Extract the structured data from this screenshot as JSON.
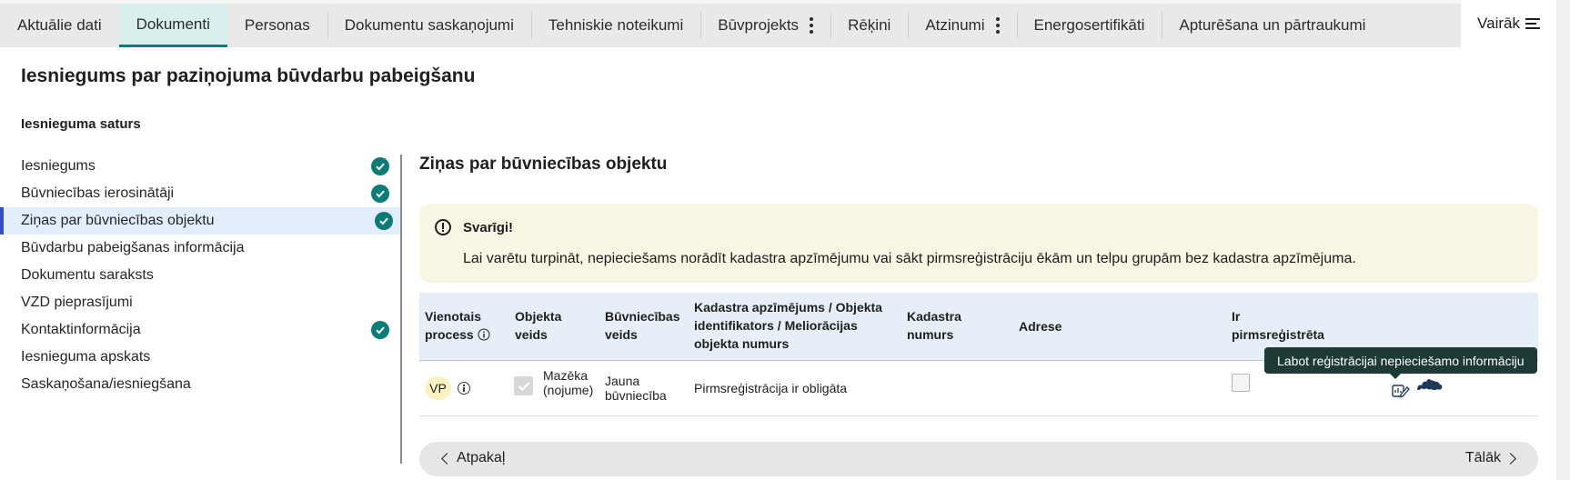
{
  "tabs": [
    {
      "label": "Aktuālie dati",
      "active": false,
      "has_menu": false
    },
    {
      "label": "Dokumenti",
      "active": true,
      "has_menu": false
    },
    {
      "label": "Personas",
      "active": false,
      "has_menu": false
    },
    {
      "label": "Dokumentu saskaņojumi",
      "active": false,
      "has_menu": false
    },
    {
      "label": "Tehniskie noteikumi",
      "active": false,
      "has_menu": false
    },
    {
      "label": "Būvprojekts",
      "active": false,
      "has_menu": true
    },
    {
      "label": "Rēķini",
      "active": false,
      "has_menu": false
    },
    {
      "label": "Atzinumi",
      "active": false,
      "has_menu": true
    },
    {
      "label": "Energosertifikāti",
      "active": false,
      "has_menu": false
    },
    {
      "label": "Apturēšana un pārtraukumi",
      "active": false,
      "has_menu": false
    }
  ],
  "more_tab": {
    "label": "Vairāk"
  },
  "page_title": "Iesniegums par paziņojuma būvdarbu pabeigšanu",
  "section_label": "Iesnieguma saturs",
  "steps": [
    {
      "label": "Iesniegums",
      "completed": true,
      "active": false
    },
    {
      "label": "Būvniecības ierosinātāji",
      "completed": true,
      "active": false
    },
    {
      "label": "Ziņas par būvniecības objektu",
      "completed": true,
      "active": true
    },
    {
      "label": "Būvdarbu pabeigšanas informācija",
      "completed": false,
      "active": false
    },
    {
      "label": "Dokumentu saraksts",
      "completed": false,
      "active": false
    },
    {
      "label": "VZD pieprasījumi",
      "completed": false,
      "active": false
    },
    {
      "label": "Kontaktinformācija",
      "completed": true,
      "active": false
    },
    {
      "label": "Iesnieguma apskats",
      "completed": false,
      "active": false
    },
    {
      "label": "Saskaņošana/iesniegšana",
      "completed": false,
      "active": false
    }
  ],
  "content": {
    "title": "Ziņas par būvniecības objektu",
    "alert": {
      "title": "Svarīgi!",
      "text": "Lai varētu turpināt, nepieciešams norādīt kadastra apzīmējumu vai sākt pirmsreģistrāciju ēkām un telpu grupām bez kadastra apzīmējuma."
    },
    "table": {
      "headers": {
        "unified_process": "Vienotais process",
        "object_type_1": "Objekta",
        "object_type_2": "veids",
        "construction_type_1": "Būvniecības",
        "construction_type_2": "veids",
        "cadastre_1": "Kadastra apzīmējums / Objekta",
        "cadastre_2": "identifikators / Meliorācijas",
        "cadastre_3": "objekta numurs",
        "cadastre_number_1": "Kadastra",
        "cadastre_number_2": "numurs",
        "address": "Adrese",
        "preregistered_1": "Ir",
        "preregistered_2": "pirmsreģistrēta"
      },
      "row": {
        "process_badge": "VP",
        "object_type_checked": true,
        "object_type_1": "Mazēka",
        "object_type_2": "(nojume)",
        "construction_type_1": "Jauna",
        "construction_type_2": "būvniecība",
        "cadastre": "Pirmsreģistrācija ir obligāta",
        "cadastre_number": "",
        "address": "",
        "preregistered": false
      }
    },
    "tooltip": "Labot reģistrācijai nepieciešamo informāciju"
  },
  "footer": {
    "back_label": "Atpakaļ",
    "next_label": "Tālāk"
  },
  "colors": {
    "accent": "#0c7c78",
    "active_nav": "#3450c5",
    "alert_bg": "#f8f5e5",
    "table_head_bg": "#e6eef7",
    "tooltip_bg": "#1d3a37",
    "badge_bg": "#fbf2c2"
  }
}
